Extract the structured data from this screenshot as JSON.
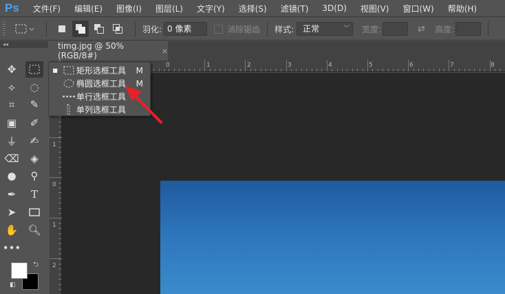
{
  "app": {
    "logo": "Ps"
  },
  "menu": [
    "文件(F)",
    "编辑(E)",
    "图像(I)",
    "图层(L)",
    "文字(Y)",
    "选择(S)",
    "滤镜(T)",
    "3D(D)",
    "视图(V)",
    "窗口(W)",
    "帮助(H)"
  ],
  "options": {
    "feather_label": "羽化:",
    "feather_value": "0 像素",
    "antialias_label": "消除锯齿",
    "style_label": "样式:",
    "style_value": "正常",
    "width_label": "宽度:",
    "height_label": "高度:"
  },
  "document_tab": {
    "title": "timg.jpg @ 50%(RGB/8#)",
    "close": "×"
  },
  "toolbox": {
    "collapse": "◂◂"
  },
  "flyout": [
    {
      "label": "矩形选框工具",
      "key": "M",
      "selected": true
    },
    {
      "label": "椭圆选框工具",
      "key": "M",
      "selected": false
    },
    {
      "label": "单行选框工具",
      "key": "",
      "selected": false
    },
    {
      "label": "单列选框工具",
      "key": "",
      "selected": false
    }
  ],
  "rulers": {
    "horizontal": [
      "0",
      "1",
      "2",
      "3",
      "4",
      "5",
      "6",
      "7",
      "8"
    ],
    "vertical": [
      "1",
      "0",
      "1",
      "2"
    ]
  },
  "colors": {
    "accent": "#4da3e9",
    "arrow": "#e8202a",
    "image_top": "#1f5a9e",
    "image_bottom": "#3a8bcc"
  }
}
